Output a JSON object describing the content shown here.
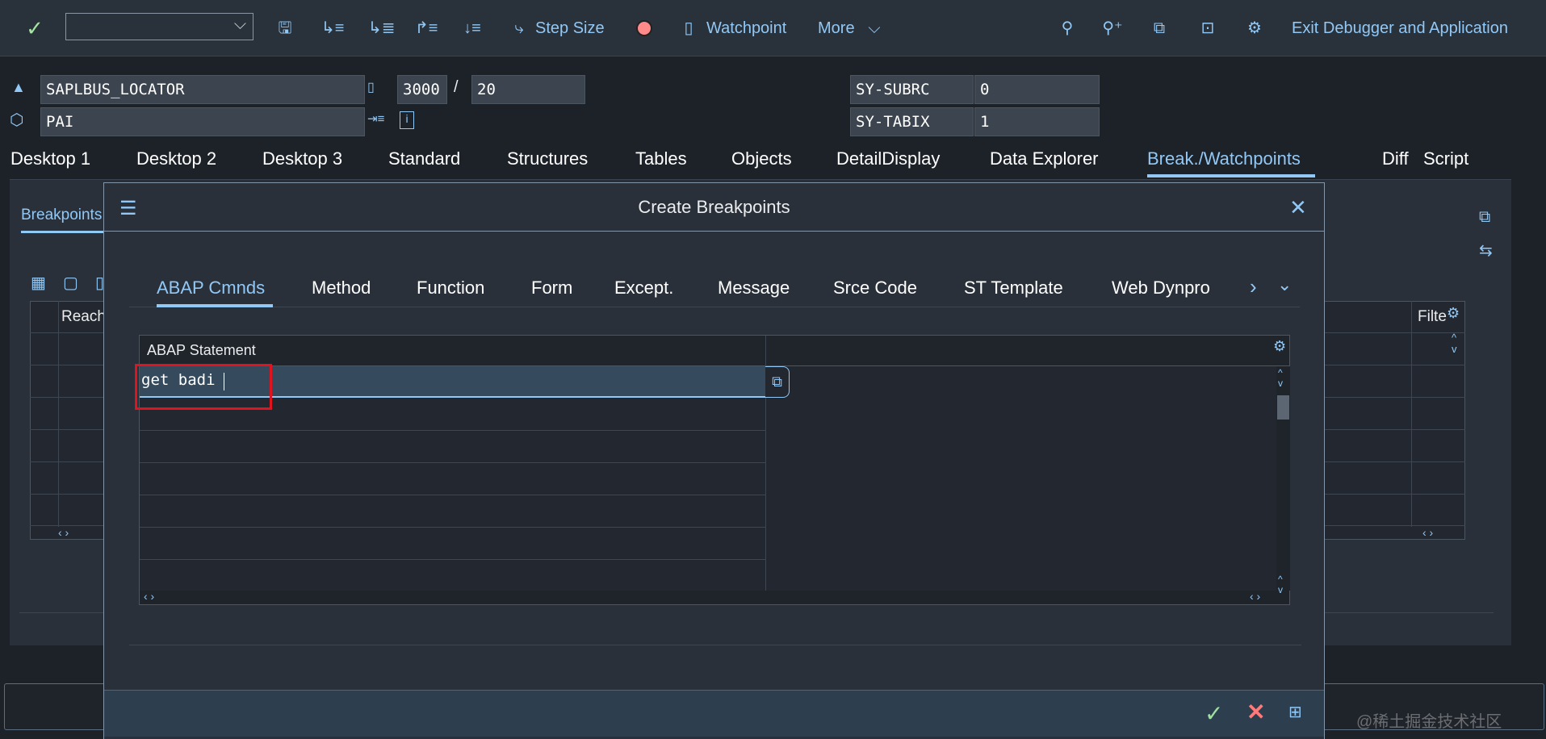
{
  "toolbar": {
    "dropdown_value": "",
    "step_size_label": "Step Size",
    "watchpoint_label": "Watchpoint",
    "more_label": "More",
    "exit_label": "Exit Debugger and Application"
  },
  "info": {
    "program": "SAPLBUS_LOCATOR",
    "screen": "3000",
    "separator": "/",
    "line": "20",
    "event": "PAI",
    "sy_fields": [
      {
        "name": "SY-SUBRC",
        "value": "0"
      },
      {
        "name": "SY-TABIX",
        "value": "1"
      }
    ]
  },
  "tabs": [
    "Desktop 1",
    "Desktop 2",
    "Desktop 3",
    "Standard",
    "Structures",
    "Tables",
    "Objects",
    "DetailDisplay",
    "Data Explorer",
    "Break./Watchpoints",
    "Diff",
    "Script"
  ],
  "active_tab": "Break./Watchpoints",
  "panel": {
    "subtab": "Breakpoints",
    "column_reach": "Reach",
    "column_filter": "Filte"
  },
  "dialog": {
    "title": "Create Breakpoints",
    "tabs": [
      "ABAP Cmnds",
      "Method",
      "Function",
      "Form",
      "Except.",
      "Message",
      "Srce Code",
      "ST Template",
      "Web Dynpro"
    ],
    "active_tab": "ABAP Cmnds",
    "table_header": "ABAP Statement",
    "input_value": "get badi",
    "highlight_color": "#e0141e"
  },
  "watermark": "@稀土掘金技术社区",
  "colors": {
    "accent": "#91c8f6",
    "ok": "#9fe0a0",
    "cancel": "#ff7b7b"
  }
}
